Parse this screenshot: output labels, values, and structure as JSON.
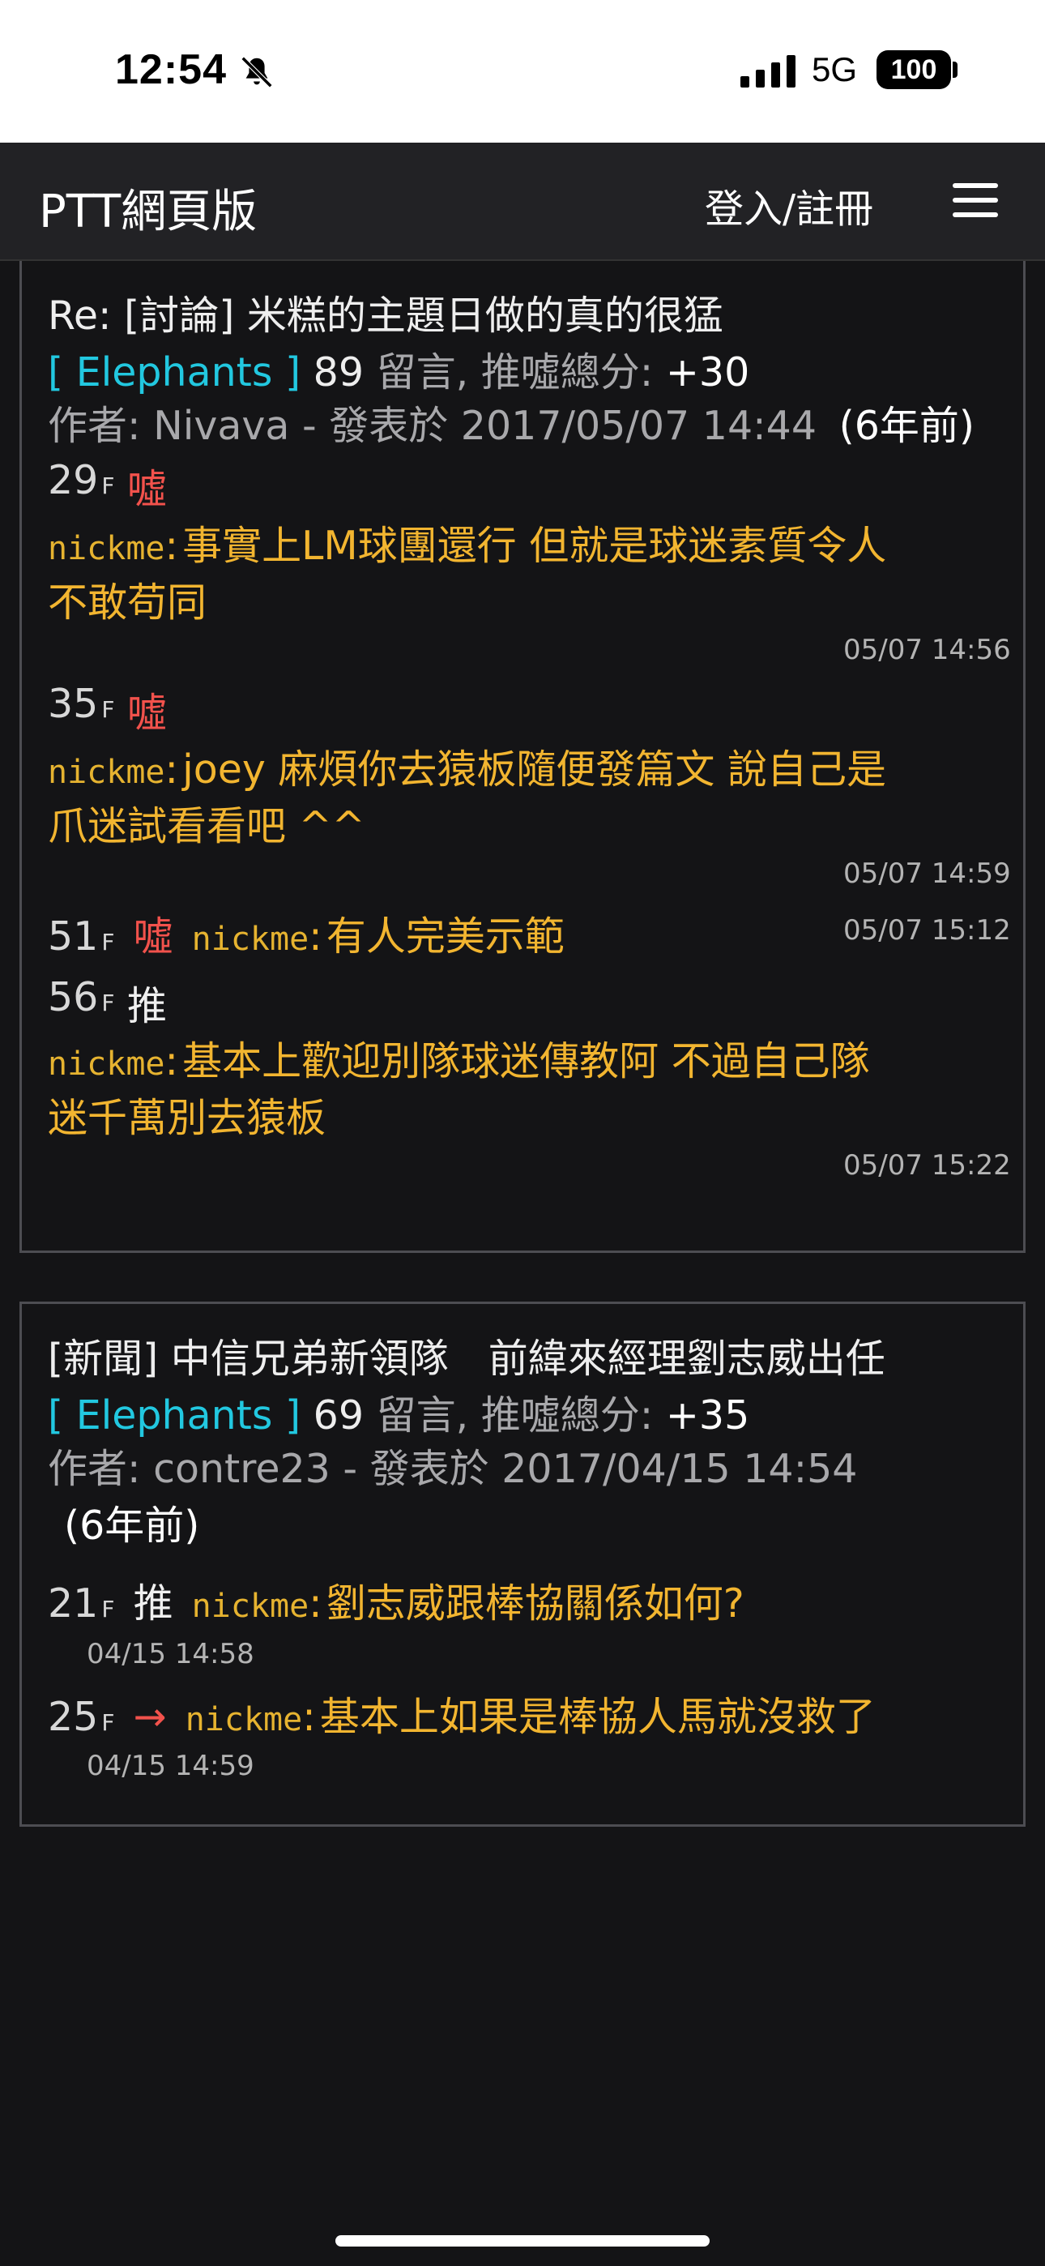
{
  "status_bar": {
    "time": "12:54",
    "network": "5G",
    "battery": "100"
  },
  "navbar": {
    "title": "PTT網頁版",
    "login": "登入/註冊"
  },
  "posts": [
    {
      "title": "Re: [討論] 米糕的主題日做的真的很猛",
      "board": "[ Elephants ]",
      "count": "89",
      "count_suffix": " 留言, 推噓總分: ",
      "score": "+30",
      "author_line": "作者: Nivava - 發表於 2017/05/07 14:44",
      "age": "(6年前)",
      "comments": [
        {
          "floor": "29",
          "floor_suffix": "F",
          "tag": "噓",
          "user": "nickme",
          "text_line1": "事實上LM球團還行 但就是球迷素質令人",
          "text_line2": "不敢苟同",
          "time": "05/07 14:56"
        },
        {
          "floor": "35",
          "floor_suffix": "F",
          "tag": "噓",
          "user": "nickme",
          "text_line1": "joey 麻煩你去猿板隨便發篇文 說自己是",
          "text_line2": "爪迷試看看吧 ^^",
          "time": "05/07 14:59"
        },
        {
          "floor": "51",
          "floor_suffix": "F",
          "tag": "噓",
          "user": "nickme",
          "text_line1": "有人完美示範",
          "time": "05/07 15:12"
        },
        {
          "floor": "56",
          "floor_suffix": "F",
          "tag": "推",
          "user": "nickme",
          "text_line1": "基本上歡迎別隊球迷傳教阿 不過自己隊",
          "text_line2": "迷千萬別去猿板",
          "time": "05/07 15:22"
        }
      ]
    },
    {
      "title": "[新聞] 中信兄弟新領隊　前緯來經理劉志威出任",
      "board": "[ Elephants ]",
      "count": "69",
      "count_suffix": " 留言, 推噓總分: ",
      "score": "+35",
      "author_line": "作者: contre23 - 發表於 2017/04/15 14:54",
      "age": "(6年前)",
      "comments": [
        {
          "floor": "21",
          "floor_suffix": "F",
          "tag": "推",
          "user": "nickme",
          "text_line1": "劉志威跟棒協關係如何?",
          "time": "04/15 14:58"
        },
        {
          "floor": "25",
          "floor_suffix": "F",
          "tag": "→",
          "user": "nickme",
          "text_line1": "基本上如果是棒協人馬就沒救了",
          "time": "04/15 14:59"
        }
      ]
    }
  ]
}
